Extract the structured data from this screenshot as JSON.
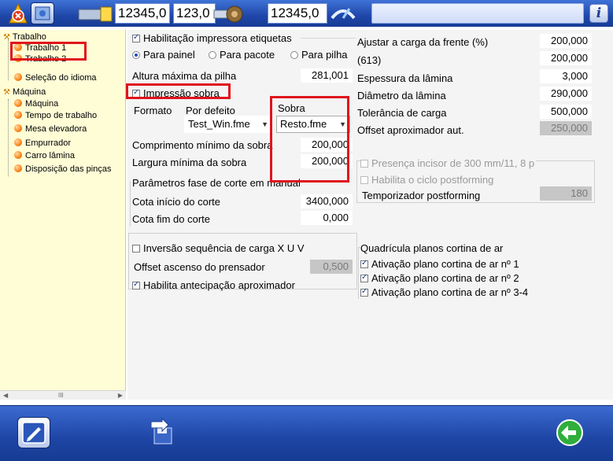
{
  "toolbar": {
    "field1": "12345,0",
    "field2": "123,0",
    "field3": "12345,0",
    "search": "",
    "icons": [
      "alarm-icon",
      "layout-icon",
      "sheet-feed-icon",
      "saw-icon",
      "speed-icon",
      "help-icon"
    ]
  },
  "tree": {
    "trabalho": "Trabalho",
    "trabalho1": "Trabalho 1",
    "trabalho2": "Trabalho 2",
    "idioma": "Seleção do idioma",
    "maquina": "Máquina",
    "maquina_child": "Máquina",
    "tempo": "Tempo de trabalho",
    "mesa": "Mesa elevadora",
    "empurrador": "Empurrador",
    "carro": "Carro lâmina",
    "disposicao": "Disposição das pinças",
    "scroll_glyph": "III"
  },
  "left": {
    "hab_impressora": "Habilitação impressora etiquetas",
    "r_painel": "Para painel",
    "r_pacote": "Para pacote",
    "r_pilha": "Para pilha",
    "altura_label": "Altura máxima da pilha",
    "altura_val": "281,001",
    "impressao_sobra": "Impressão sobra",
    "formato": "Formato",
    "por_defeito": "Por defeito",
    "sobra": "Sobra",
    "dd_default": "Test_Win.fme",
    "dd_sobra": "Resto.fme",
    "comp_label": "Comprimento mínimo da sobra",
    "comp_val": "200,000",
    "larg_label": "Largura mínima da sobra",
    "larg_val": "200,000",
    "param_title": "Parâmetros fase de corte em manual",
    "cota_ini_label": "Cota início do corte",
    "cota_ini_val": "3400,000",
    "cota_fim_label": "Cota fim do corte",
    "cota_fim_val": "0,000",
    "inversao": "Inversão sequência de carga X U V",
    "offset_asc_label": "Offset ascenso do prensador",
    "offset_asc_val": "0,500",
    "antecipacao": "Habilita antecipação aproximador"
  },
  "right": {
    "ajustar_label": "Ajustar a carga da frente (%)",
    "ajustar_val": "200,000",
    "r613_label": "(613)",
    "r613_val": "200,000",
    "espessura_label": "Espessura da lâmina",
    "espessura_val": "3,000",
    "diametro_label": "Diâmetro da lâmina",
    "diametro_val": "290,000",
    "tolerancia_label": "Tolerância de carga",
    "tolerancia_val": "500,000",
    "offset_aut_label": "Offset aproximador aut.",
    "offset_aut_val": "250,000",
    "presenca": "Presença incisor de 300 mm/11, 8 p",
    "habilita_ciclo": "Habilita o ciclo postforming",
    "temporizador_label": "Temporizador postforming",
    "temporizador_val": "180",
    "quadricula": "Quadrícula planos cortina de ar",
    "plano1": "Ativação plano cortina de ar nº 1",
    "plano2": "Ativação plano cortina de ar nº 2",
    "plano34": "Ativação plano cortina de ar nº 3-4"
  },
  "bottom": {
    "icons": [
      "edit-icon",
      "save-icon",
      "back-arrow-icon"
    ]
  },
  "colors": {
    "highlight": "#e0131c",
    "toolbar": "#1f46a8",
    "tree_bg": "#fffdd6"
  }
}
